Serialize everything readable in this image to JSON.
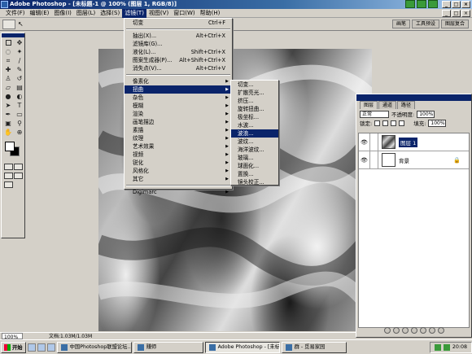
{
  "app": {
    "title": "Adobe Photoshop - [未标题-1 @ 100% (图层 1, RGB/8)]",
    "window_buttons": [
      "_",
      "□",
      "×"
    ]
  },
  "menubar": {
    "items": [
      "文件(F)",
      "编辑(E)",
      "图像(I)",
      "图层(L)",
      "选择(S)",
      "滤镜(T)",
      "视图(V)",
      "窗口(W)",
      "帮助(H)"
    ],
    "active_index": 5
  },
  "palette_well": {
    "tabs": [
      "画笔",
      "工具预设",
      "图层复合"
    ]
  },
  "filter_menu": {
    "items": [
      {
        "label": "切变",
        "shortcut": "Ctrl+F",
        "submenu": false,
        "sep_after": true
      },
      {
        "label": "抽出(X)...",
        "shortcut": "Alt+Ctrl+X",
        "submenu": false,
        "sep_after": false
      },
      {
        "label": "滤镜库(G)...",
        "shortcut": "",
        "submenu": false,
        "sep_after": false
      },
      {
        "label": "液化(L)...",
        "shortcut": "Shift+Ctrl+X",
        "submenu": false,
        "sep_after": false
      },
      {
        "label": "图案生成器(P)...",
        "shortcut": "Alt+Shift+Ctrl+X",
        "submenu": false,
        "sep_after": false
      },
      {
        "label": "消失点(V)...",
        "shortcut": "Alt+Ctrl+V",
        "submenu": false,
        "sep_after": true
      },
      {
        "label": "像素化",
        "shortcut": "",
        "submenu": true,
        "sep_after": false
      },
      {
        "label": "扭曲",
        "shortcut": "",
        "submenu": true,
        "sep_after": false,
        "highlighted": true
      },
      {
        "label": "杂色",
        "shortcut": "",
        "submenu": true,
        "sep_after": false
      },
      {
        "label": "模糊",
        "shortcut": "",
        "submenu": true,
        "sep_after": false
      },
      {
        "label": "渲染",
        "shortcut": "",
        "submenu": true,
        "sep_after": false
      },
      {
        "label": "画笔描边",
        "shortcut": "",
        "submenu": true,
        "sep_after": false
      },
      {
        "label": "素描",
        "shortcut": "",
        "submenu": true,
        "sep_after": false
      },
      {
        "label": "纹理",
        "shortcut": "",
        "submenu": true,
        "sep_after": false
      },
      {
        "label": "艺术效果",
        "shortcut": "",
        "submenu": true,
        "sep_after": false
      },
      {
        "label": "视频",
        "shortcut": "",
        "submenu": true,
        "sep_after": false
      },
      {
        "label": "锐化",
        "shortcut": "",
        "submenu": true,
        "sep_after": false
      },
      {
        "label": "风格化",
        "shortcut": "",
        "submenu": true,
        "sep_after": false
      },
      {
        "label": "其它",
        "shortcut": "",
        "submenu": true,
        "sep_after": true
      },
      {
        "label": "Digimarc",
        "shortcut": "",
        "submenu": true,
        "sep_after": false
      }
    ]
  },
  "distort_submenu": {
    "items": [
      "切变...",
      "扩散亮光...",
      "挤压...",
      "旋转扭曲...",
      "极坐标...",
      "水波...",
      "波浪...",
      "波纹...",
      "海洋波纹...",
      "玻璃...",
      "球面化...",
      "置换...",
      "镜头校正..."
    ],
    "highlighted_index": 6
  },
  "layers_panel": {
    "tabs": [
      "图层",
      "通道",
      "路径"
    ],
    "blend_mode": "正常",
    "opacity_label": "不透明度:",
    "opacity_value": "100%",
    "lock_label": "锁定:",
    "fill_label": "填充:",
    "fill_value": "100%",
    "layers": [
      {
        "name": "图层 1",
        "selected": true,
        "locked": false
      },
      {
        "name": "背景",
        "selected": false,
        "locked": true
      }
    ]
  },
  "statusbar": {
    "zoom": "100%",
    "doc_size": "文档:1.03M/1.03M"
  },
  "taskbar": {
    "start_label": "开始",
    "tasks": [
      {
        "label": "中国Photoshop联盟论坛...",
        "active": false
      },
      {
        "label": "赚师",
        "active": false
      },
      {
        "label": "Adobe Photoshop - [未标...",
        "active": true
      },
      {
        "label": "群 - 觅易家园",
        "active": false
      }
    ],
    "clock": "20:08"
  }
}
